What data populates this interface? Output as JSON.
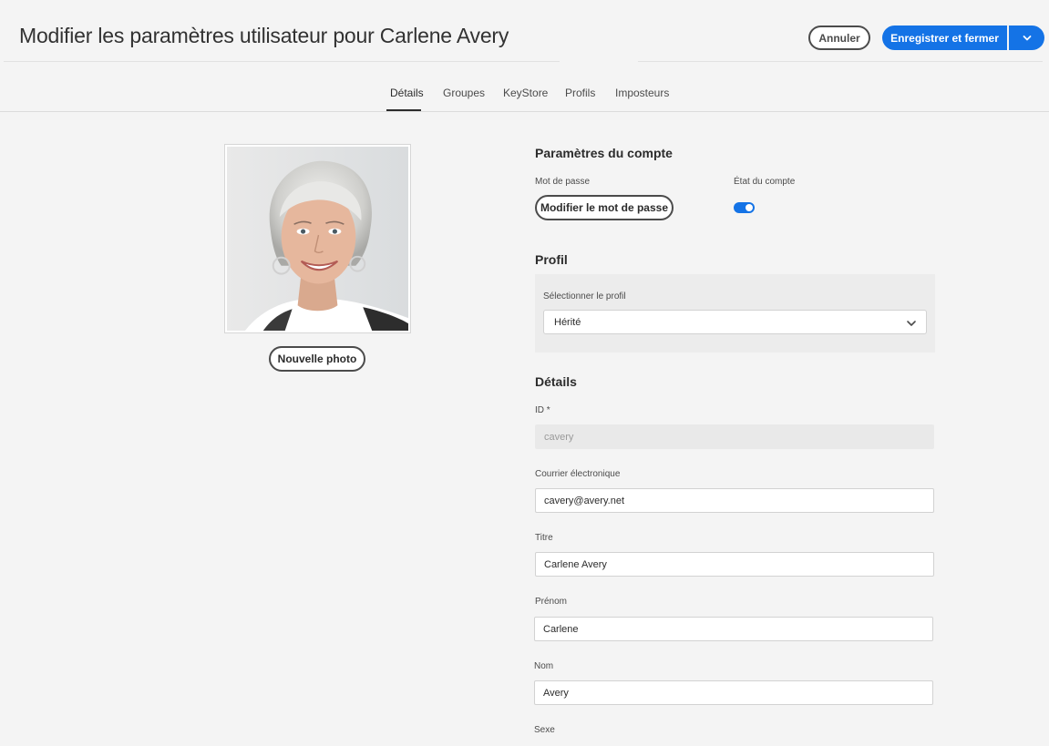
{
  "header": {
    "title": "Modifier les paramètres utilisateur pour Carlene Avery",
    "cancel_label": "Annuler",
    "save_close_label": "Enregistrer et fermer"
  },
  "tabs": [
    {
      "label": "Détails",
      "active": true
    },
    {
      "label": "Groupes",
      "active": false
    },
    {
      "label": "KeyStore",
      "active": false
    },
    {
      "label": "Profils",
      "active": false
    },
    {
      "label": "Imposteurs",
      "active": false
    }
  ],
  "photo": {
    "new_photo_label": "Nouvelle photo"
  },
  "account": {
    "heading": "Paramètres du compte",
    "password_label": "Mot de passe",
    "change_password_label": "Modifier le mot de passe",
    "status_label": "État du compte",
    "status_enabled": true
  },
  "profile": {
    "heading": "Profil",
    "select_label": "Sélectionner le profil",
    "select_value": "Hérité"
  },
  "details": {
    "heading": "Détails",
    "id_label": "ID *",
    "id_value": "cavery",
    "email_label": "Courrier électronique",
    "email_value": "cavery@avery.net",
    "title_label": "Titre",
    "title_value": "Carlene Avery",
    "firstname_label": "Prénom",
    "firstname_value": "Carlene",
    "lastname_label": "Nom",
    "lastname_value": "Avery",
    "gender_label": "Sexe"
  },
  "colors": {
    "accent": "#1473e6",
    "background": "#f4f4f4"
  }
}
